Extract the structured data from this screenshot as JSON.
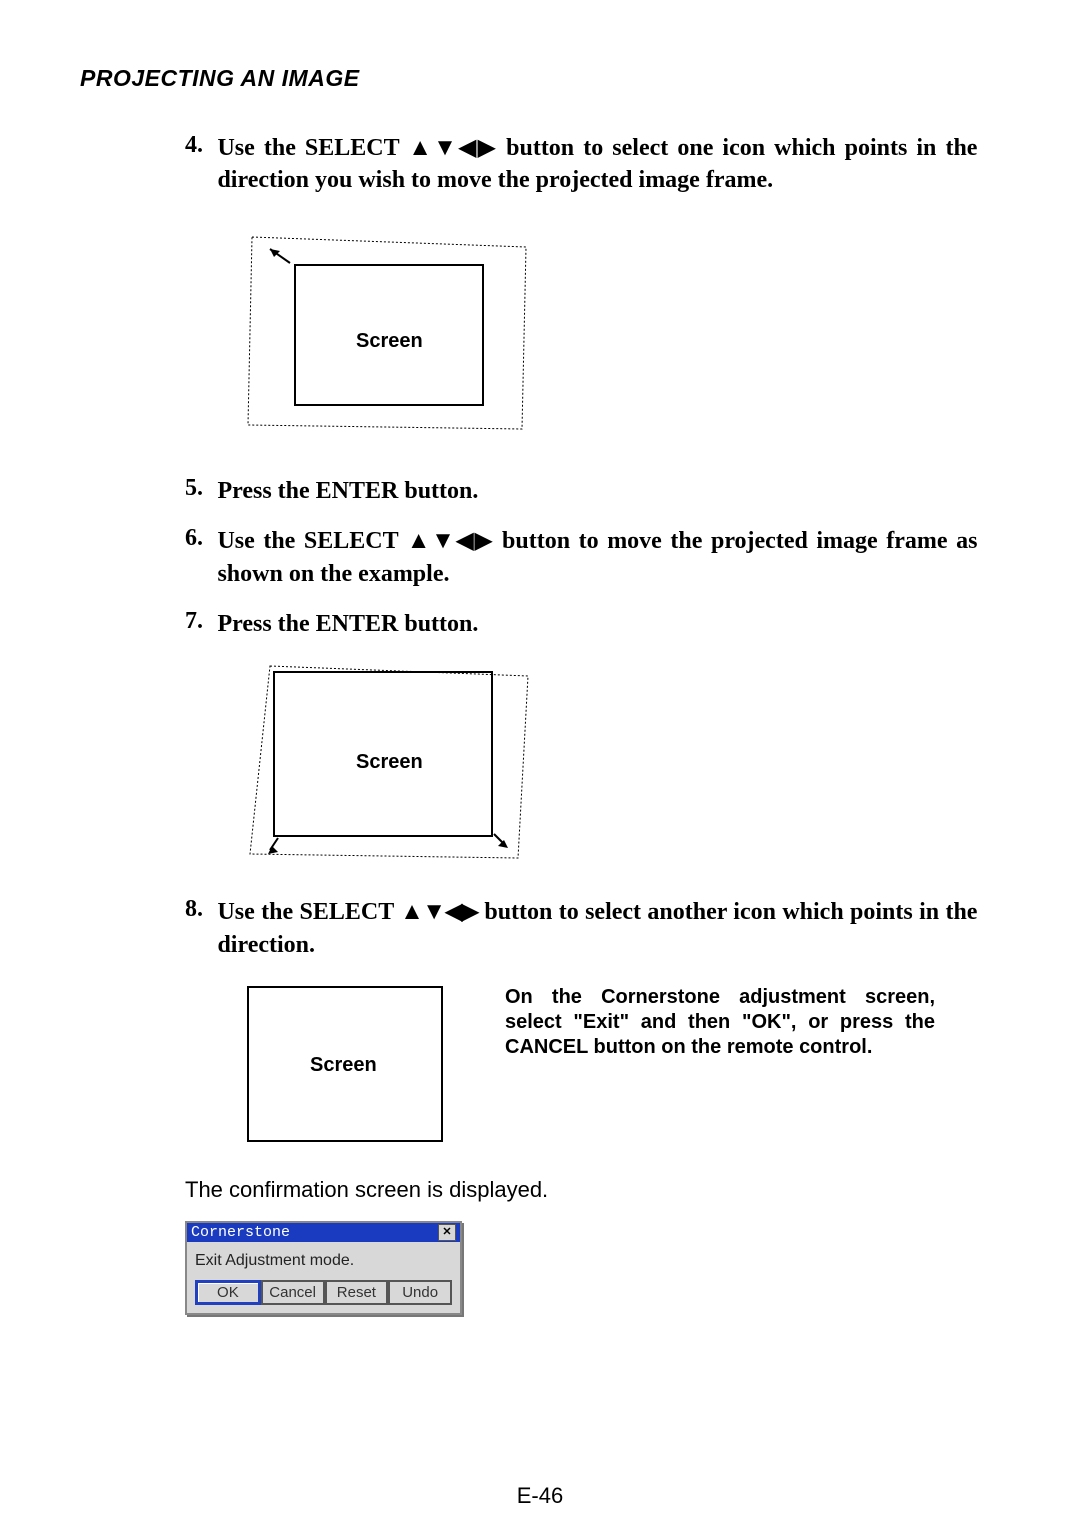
{
  "header": "PROJECTING AN IMAGE",
  "steps": {
    "s4": {
      "num": "4.",
      "pre": "Use the SELECT ",
      "arrows": "▲▼◀▶",
      "post": " button to select one icon which points in the direction you wish to move the projected image frame."
    },
    "s5": {
      "num": "5.",
      "text": "Press the ENTER button."
    },
    "s6": {
      "num": "6.",
      "pre": "Use the SELECT ",
      "arrows": "▲▼◀▶",
      "post": " button to move the projected image frame as shown on the example."
    },
    "s7": {
      "num": "7.",
      "text": "Press the ENTER button."
    },
    "s8": {
      "num": "8.",
      "pre": "Use the SELECT ",
      "arrows": "▲▼◀▶",
      "post": " button to select another icon which points in the direction."
    }
  },
  "diagram": {
    "label1": "Screen",
    "label2": "Screen",
    "label3": "Screen"
  },
  "adjust_note": "On the Cornerstone adjustment screen, select \"Exit\" and then \"OK\", or press the CANCEL button on the remote control.",
  "confirm_text": "The confirmation screen is displayed.",
  "dialog": {
    "title": "Cornerstone",
    "body": "Exit Adjustment mode.",
    "close_glyph": "✕",
    "buttons": {
      "ok": "OK",
      "cancel": "Cancel",
      "reset": "Reset",
      "undo": "Undo"
    }
  },
  "page_number": "E-46"
}
